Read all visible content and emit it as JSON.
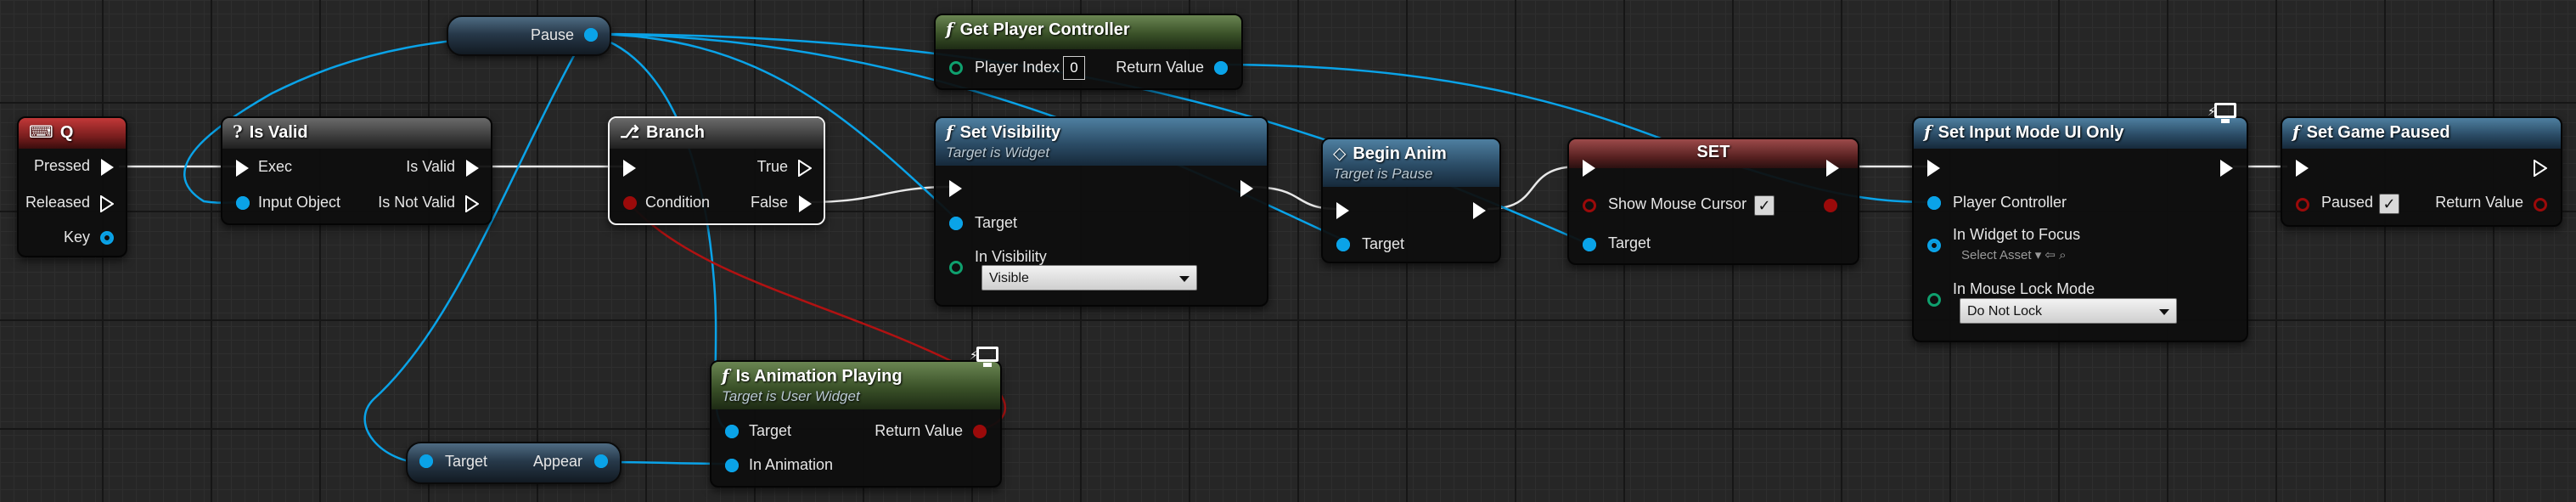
{
  "colors": {
    "exec_wire": "#ffffff",
    "object_wire": "#0aa3e8",
    "bool_wire": "#9b0a0a",
    "function_header": "#3a5128",
    "target_header": "#2b4c66",
    "event_header": "#7a1e1e"
  },
  "nodes": {
    "key_q": {
      "title": "Q",
      "icon": "keyboard-icon",
      "pins": {
        "pressed": "Pressed",
        "released": "Released",
        "key": "Key"
      }
    },
    "is_valid": {
      "title": "Is Valid",
      "icon": "question-icon",
      "pins": {
        "exec": "Exec",
        "input_object": "Input Object",
        "is_valid": "Is Valid",
        "is_not_valid": "Is Not Valid"
      }
    },
    "branch": {
      "title": "Branch",
      "icon": "branch-icon",
      "pins": {
        "condition": "Condition",
        "true": "True",
        "false": "False"
      }
    },
    "pause_var": {
      "label": "Pause"
    },
    "get_player_controller": {
      "title": "Get Player Controller",
      "icon": "function-icon",
      "pins": {
        "player_index": "Player Index",
        "player_index_value": "0",
        "return_value": "Return Value"
      }
    },
    "set_visibility": {
      "title": "Set Visibility",
      "subtitle": "Target is Widget",
      "icon": "function-icon",
      "pins": {
        "target": "Target",
        "in_visibility": "In Visibility",
        "visibility_value": "Visible"
      }
    },
    "begin_anim": {
      "title": "Begin Anim",
      "subtitle": "Target is Pause",
      "icon": "event-diamond-icon",
      "pins": {
        "target": "Target"
      }
    },
    "set_node": {
      "title": "SET",
      "pins": {
        "show_mouse_cursor": "Show Mouse Cursor",
        "target": "Target"
      }
    },
    "set_input_mode": {
      "title": "Set Input Mode UI Only",
      "icon": "function-icon",
      "pins": {
        "player_controller": "Player Controller",
        "in_widget_to_focus": "In Widget to Focus",
        "select_asset": "Select Asset",
        "in_mouse_lock_mode": "In Mouse Lock Mode",
        "mouse_lock_value": "Do Not Lock"
      }
    },
    "set_game_paused": {
      "title": "Set Game Paused",
      "icon": "function-icon",
      "pins": {
        "paused": "Paused",
        "return_value": "Return Value"
      }
    },
    "is_animation_playing": {
      "title": "Is Animation Playing",
      "subtitle": "Target is User Widget",
      "icon": "function-icon",
      "pins": {
        "target": "Target",
        "in_animation": "In Animation",
        "return_value": "Return Value"
      }
    },
    "target_appear_var": {
      "left": "Target",
      "right": "Appear"
    }
  }
}
